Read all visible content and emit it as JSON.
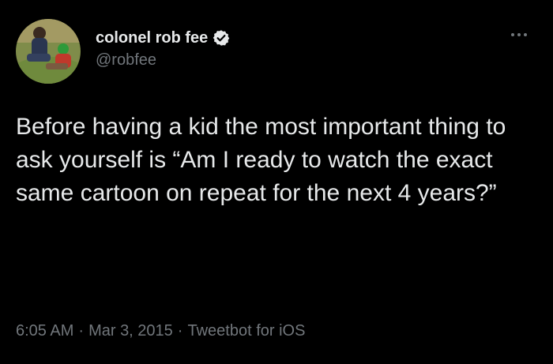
{
  "author": {
    "display_name": "colonel rob fee",
    "handle": "@robfee",
    "verified": true,
    "avatar_icon": "profile-photo"
  },
  "tweet": {
    "text": "Before having a kid the most important thing to ask yourself is “Am I ready to watch the exact same cartoon on repeat for the next 4 years?”",
    "time": "6:05 AM",
    "date": "Mar 3, 2015",
    "source": "Tweetbot for iOS",
    "separator": "·"
  },
  "colors": {
    "background": "#000000",
    "text_primary": "#e7e9ea",
    "text_secondary": "#71767b",
    "verified_badge": "#e7e9ea"
  }
}
